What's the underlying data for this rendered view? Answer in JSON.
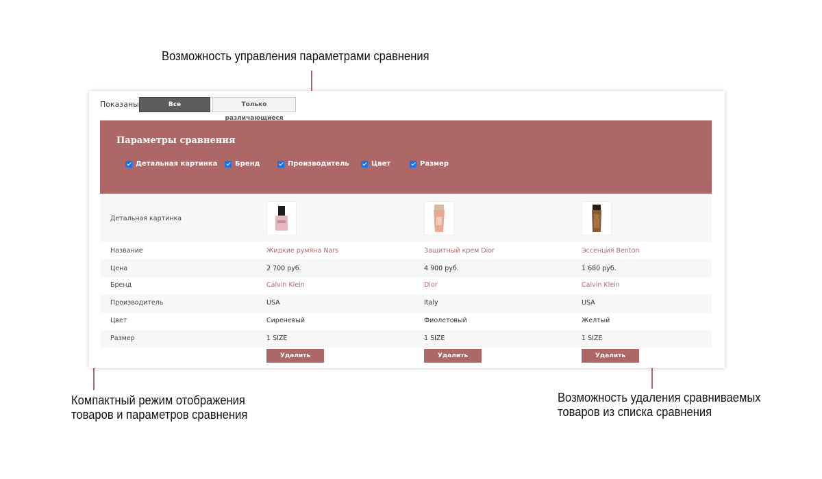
{
  "callouts": {
    "top": "Возможность управления параметрами сравнения",
    "left_line1": "Компактный режим отображения",
    "left_line2": "товаров и параметров сравнения",
    "right_line1": "Возможность удаления сравниваемых",
    "right_line2": "товаров из списка сравнения"
  },
  "toolbar": {
    "shown_label": "Показаны:",
    "all_label": "Все характеристики",
    "diff_label": "Только различающиеся"
  },
  "params": {
    "title": "Параметры сравнения",
    "items": [
      {
        "label": "Детальная картинка",
        "checked": true
      },
      {
        "label": "Бренд",
        "checked": true
      },
      {
        "label": "Производитель",
        "checked": true
      },
      {
        "label": "Цвет",
        "checked": true
      },
      {
        "label": "Размер",
        "checked": true
      }
    ]
  },
  "table": {
    "rows": {
      "image": "Детальная картинка",
      "name": "Название",
      "price": "Цена",
      "brand": "Бренд",
      "maker": "Производитель",
      "color": "Цвет",
      "size": "Размер"
    },
    "products": [
      {
        "name": "Жидкие румяна Nars",
        "price": "2 700 руб.",
        "brand": "Calvin Klein",
        "maker": "USA",
        "color": "Сиреневый",
        "size": "1 SIZE",
        "delete": "Удалить",
        "image": "nail-polish-bottle-icon"
      },
      {
        "name": "Защитный крем Dior",
        "price": "4 900 руб.",
        "brand": "Dior",
        "maker": "Italy",
        "color": "Фиолетовый",
        "size": "1 SIZE",
        "delete": "Удалить",
        "image": "cream-tube-icon"
      },
      {
        "name": "Эссенция Benton",
        "price": "1 680 руб.",
        "brand": "Calvin Klein",
        "maker": "USA",
        "color": "Желтый",
        "size": "1 SIZE",
        "delete": "Удалить",
        "image": "bronze-tube-icon"
      }
    ]
  },
  "colors": {
    "accent": "#ad6767",
    "link": "#a86a6a",
    "row_shade": "#f7f7f7"
  }
}
